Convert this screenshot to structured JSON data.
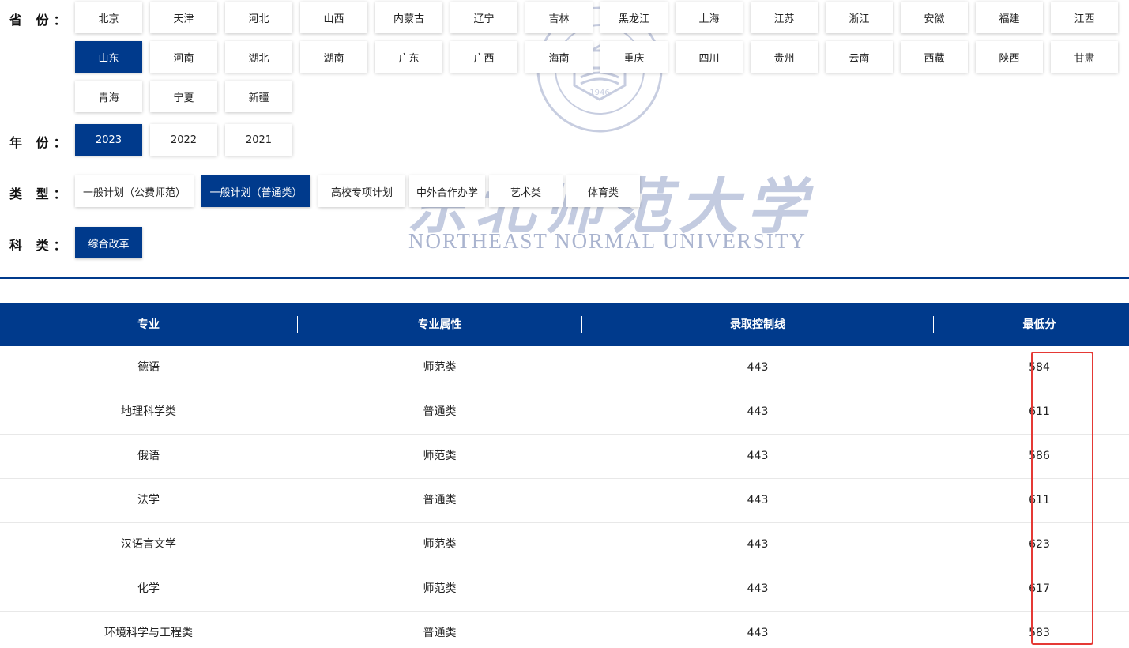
{
  "filters": {
    "province_label": "省 份：",
    "year_label": "年 份：",
    "type_label": "类 型：",
    "category_label": "科 类：",
    "provinces": [
      "北京",
      "天津",
      "河北",
      "山西",
      "内蒙古",
      "辽宁",
      "吉林",
      "黑龙江",
      "上海",
      "江苏",
      "浙江",
      "安徽",
      "福建",
      "江西",
      "山东",
      "河南",
      "湖北",
      "湖南",
      "广东",
      "广西",
      "海南",
      "重庆",
      "四川",
      "贵州",
      "云南",
      "西藏",
      "陕西",
      "甘肃",
      "青海",
      "宁夏",
      "新疆"
    ],
    "selected_province": "山东",
    "years": [
      "2023",
      "2022",
      "2021"
    ],
    "selected_year": "2023",
    "types": [
      "一般计划（公费师范）",
      "一般计划（普通类）",
      "高校专项计划",
      "中外合作办学",
      "艺术类",
      "体育类"
    ],
    "selected_type": "一般计划（普通类）",
    "categories": [
      "综合改革"
    ],
    "selected_category": "综合改革"
  },
  "watermark": {
    "cn": "东北师范大学",
    "en": "NORTHEAST NORMAL UNIVERSITY",
    "seal_year": "1946"
  },
  "table": {
    "headers": [
      "专业",
      "专业属性",
      "录取控制线",
      "最低分"
    ],
    "rows": [
      [
        "德语",
        "师范类",
        "443",
        "584"
      ],
      [
        "地理科学类",
        "普通类",
        "443",
        "611"
      ],
      [
        "俄语",
        "师范类",
        "443",
        "586"
      ],
      [
        "法学",
        "普通类",
        "443",
        "611"
      ],
      [
        "汉语言文学",
        "师范类",
        "443",
        "623"
      ],
      [
        "化学",
        "师范类",
        "443",
        "617"
      ],
      [
        "环境科学与工程类",
        "普通类",
        "443",
        "583"
      ]
    ]
  },
  "colors": {
    "primary": "#003a8c",
    "highlight": "#e53935"
  }
}
